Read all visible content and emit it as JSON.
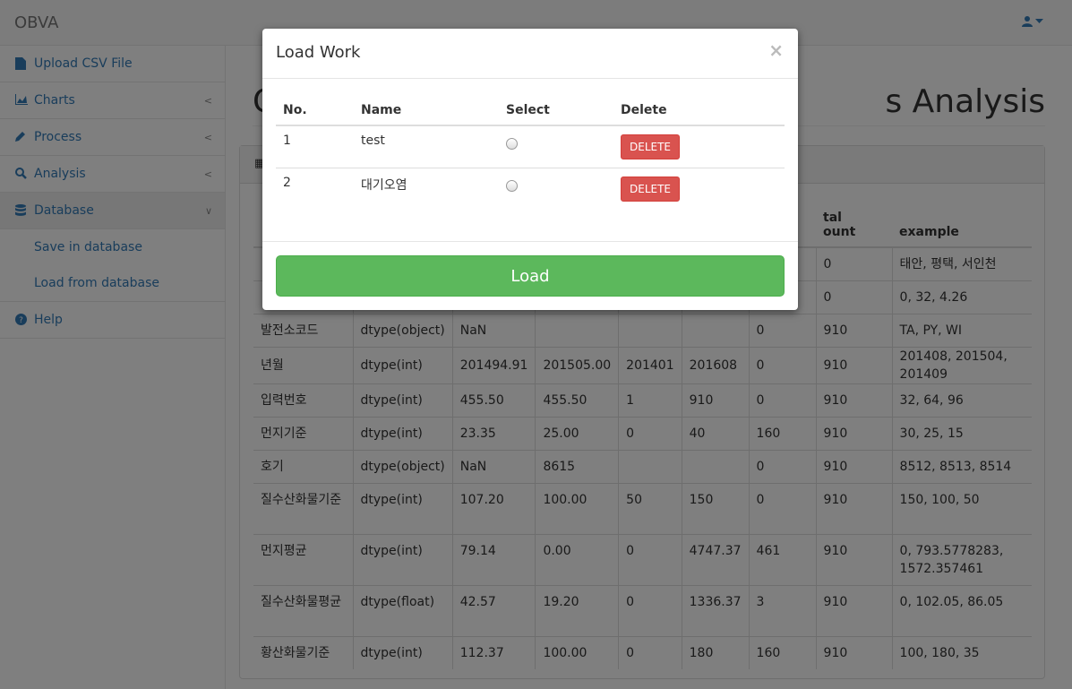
{
  "app": {
    "brand": "OBVA"
  },
  "sidebar": {
    "items": [
      {
        "label": "Upload CSV File",
        "icon": "file-icon"
      },
      {
        "label": "Charts",
        "icon": "chart-icon"
      },
      {
        "label": "Process",
        "icon": "pencil-icon"
      },
      {
        "label": "Analysis",
        "icon": "search-icon"
      },
      {
        "label": "Database",
        "icon": "database-icon"
      },
      {
        "label": "Help",
        "icon": "question-icon"
      }
    ],
    "database_sub": [
      {
        "label": "Save in database"
      },
      {
        "label": "Load from database"
      }
    ]
  },
  "page": {
    "title_left": "C",
    "title_right": "s Analysis",
    "table": {
      "headers": [
        "",
        "",
        "",
        "",
        "",
        "",
        "tal\nount",
        "example"
      ],
      "rows": [
        [
          "",
          "",
          "",
          "",
          "",
          "",
          "0",
          "태안, 평택, 서인천"
        ],
        [
          "",
          "",
          "",
          "",
          "",
          "",
          "0",
          "0, 32, 4.26"
        ],
        [
          "발전소코드",
          "dtype(object)",
          "NaN",
          "",
          "",
          "",
          "0",
          "910",
          "TA, PY, WI"
        ],
        [
          "년월",
          "dtype(int)",
          "201494.91",
          "201505.00",
          "201401",
          "201608",
          "0",
          "910",
          "201408, 201504, 201409"
        ],
        [
          "입력번호",
          "dtype(int)",
          "455.50",
          "455.50",
          "1",
          "910",
          "0",
          "910",
          "32, 64, 96"
        ],
        [
          "먼지기준",
          "dtype(int)",
          "23.35",
          "25.00",
          "0",
          "40",
          "160",
          "910",
          "30, 25, 15"
        ],
        [
          "호기",
          "dtype(object)",
          "NaN",
          "8615",
          "",
          "",
          "0",
          "910",
          "8512, 8513, 8514"
        ],
        [
          "질수산화물기준",
          "dtype(int)",
          "107.20",
          "100.00",
          "50",
          "150",
          "0",
          "910",
          "150, 100, 50"
        ],
        [
          "먼지평균",
          "dtype(int)",
          "79.14",
          "0.00",
          "0",
          "4747.37",
          "461",
          "910",
          "0, 793.5778283, 1572.357461"
        ],
        [
          "질수산화물평균",
          "dtype(float)",
          "42.57",
          "19.20",
          "0",
          "1336.37",
          "3",
          "910",
          "0, 102.05, 86.05"
        ],
        [
          "황산화물기준",
          "dtype(int)",
          "112.37",
          "100.00",
          "0",
          "180",
          "160",
          "910",
          "100, 180, 35"
        ]
      ]
    }
  },
  "modal": {
    "title": "Load Work",
    "close": "×",
    "headers": {
      "no": "No.",
      "name": "Name",
      "select": "Select",
      "delete": "Delete"
    },
    "rows": [
      {
        "no": "1",
        "name": "test",
        "delete_label": "DELETE"
      },
      {
        "no": "2",
        "name": "대기오염",
        "delete_label": "DELETE"
      }
    ],
    "load_label": "Load"
  },
  "colors": {
    "primary": "#337ab7",
    "danger": "#d9534f",
    "success": "#5cb85c"
  }
}
